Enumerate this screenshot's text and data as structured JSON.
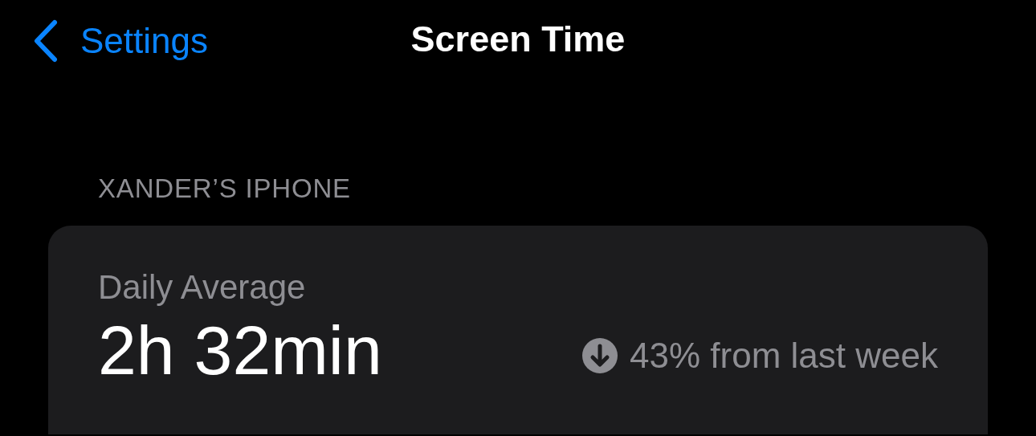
{
  "nav": {
    "back_label": "Settings",
    "title": "Screen Time"
  },
  "section_header": "XANDER’S IPHONE",
  "card": {
    "label": "Daily Average",
    "value": "2h 32min",
    "change": {
      "kind": "decrease",
      "text": "43% from last week"
    }
  }
}
